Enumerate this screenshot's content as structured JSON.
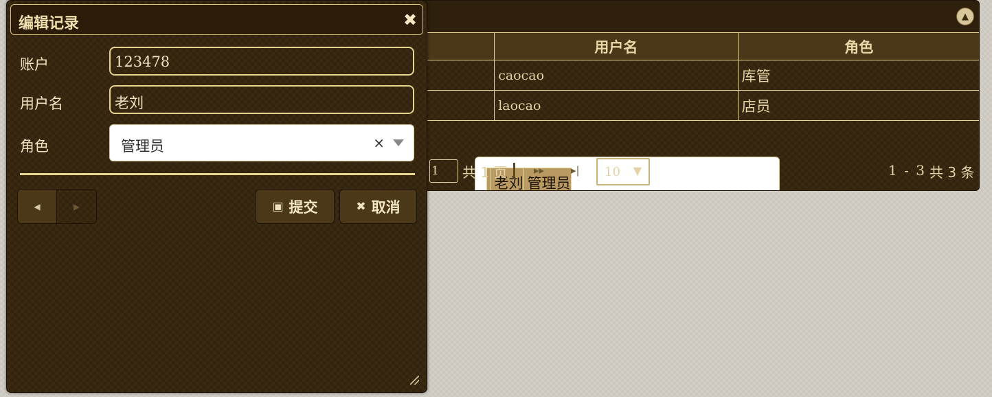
{
  "grid": {
    "columns": [
      "",
      "用户名",
      "角色"
    ],
    "rows": [
      {
        "account": "",
        "username": "caocao",
        "role": "库管"
      },
      {
        "account": "",
        "username": "laocao",
        "role": "店员"
      },
      {
        "account": "",
        "username": "老刘",
        "role": "管理员"
      }
    ],
    "pager": {
      "page": "1",
      "total_pages": "共 1 页",
      "page_size": "10",
      "range": "1 - 3",
      "total_records": "共 3 条"
    }
  },
  "dialog": {
    "title": "编辑记录",
    "fields": {
      "account_label": "账户",
      "account_value": "123478",
      "username_label": "用户名",
      "username_value": "老刘",
      "role_label": "角色",
      "role_value": "管理员"
    },
    "buttons": {
      "submit": "提交",
      "cancel": "取消"
    }
  },
  "colors": {
    "panel_bg": "#3b2a12",
    "accent_border": "#e6d58f",
    "selected_row": "#b99a62",
    "page_bg": "#ccc8bf"
  },
  "icons": [
    "close-icon",
    "collapse-icon",
    "save-icon",
    "cancel-icon",
    "prev-icon",
    "next-icon",
    "clear-icon",
    "dropdown-arrow-icon",
    "resize-grip-icon"
  ]
}
